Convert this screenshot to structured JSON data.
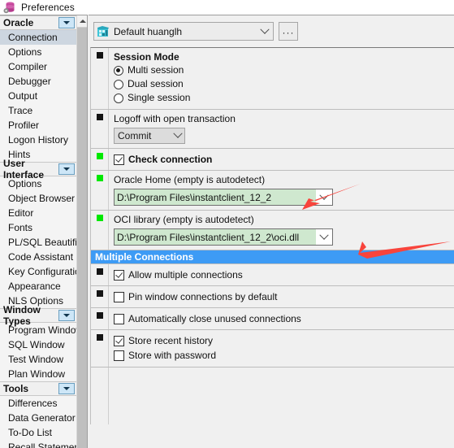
{
  "window": {
    "title": "Preferences",
    "icon": "database-gear-icon"
  },
  "sidebar": {
    "scroll_up_icon": "caret-up-icon",
    "groups": [
      {
        "label": "Oracle",
        "toggle_icon": "chevron-down-icon",
        "items": [
          {
            "label": "Connection",
            "selected": true
          },
          {
            "label": "Options",
            "selected": false
          },
          {
            "label": "Compiler",
            "selected": false
          },
          {
            "label": "Debugger",
            "selected": false
          },
          {
            "label": "Output",
            "selected": false
          },
          {
            "label": "Trace",
            "selected": false
          },
          {
            "label": "Profiler",
            "selected": false
          },
          {
            "label": "Logon History",
            "selected": false
          },
          {
            "label": "Hints",
            "selected": false
          }
        ]
      },
      {
        "label": "User Interface",
        "toggle_icon": "chevron-down-icon",
        "items": [
          {
            "label": "Options",
            "selected": false
          },
          {
            "label": "Object Browser",
            "selected": false
          },
          {
            "label": "Editor",
            "selected": false
          },
          {
            "label": "Fonts",
            "selected": false
          },
          {
            "label": "PL/SQL Beautifier",
            "selected": false
          },
          {
            "label": "Code Assistant",
            "selected": false
          },
          {
            "label": "Key Configuration",
            "selected": false
          },
          {
            "label": "Appearance",
            "selected": false
          },
          {
            "label": "NLS Options",
            "selected": false
          }
        ]
      },
      {
        "label": "Window Types",
        "toggle_icon": "chevron-down-icon",
        "items": [
          {
            "label": "Program Window",
            "selected": false
          },
          {
            "label": "SQL Window",
            "selected": false
          },
          {
            "label": "Test Window",
            "selected": false
          },
          {
            "label": "Plan Window",
            "selected": false
          }
        ]
      },
      {
        "label": "Tools",
        "toggle_icon": "chevron-down-icon",
        "items": [
          {
            "label": "Differences",
            "selected": false
          },
          {
            "label": "Data Generator",
            "selected": false
          },
          {
            "label": "To-Do List",
            "selected": false
          },
          {
            "label": "Recall Statement",
            "selected": false
          }
        ]
      }
    ]
  },
  "main": {
    "profile": {
      "icon": "preference-set-icon",
      "value": "Default huanglh",
      "chevron_icon": "chevron-down-icon",
      "more_button_label": "···"
    },
    "session_mode": {
      "title": "Session Mode",
      "marker": "black",
      "options": [
        {
          "label": "Multi session",
          "checked": true
        },
        {
          "label": "Dual session",
          "checked": false
        },
        {
          "label": "Single session",
          "checked": false
        }
      ]
    },
    "logoff": {
      "label": "Logoff with open transaction",
      "marker": "black",
      "value": "Commit",
      "chevron_icon": "chevron-down-icon"
    },
    "check_connection": {
      "label": "Check connection",
      "marker": "green",
      "checked": true
    },
    "oracle_home": {
      "label": "Oracle Home (empty is autodetect)",
      "marker": "green",
      "value": "D:\\Program Files\\instantclient_12_2",
      "chevron_icon": "chevron-down-icon"
    },
    "oci_library": {
      "label": "OCI library (empty is autodetect)",
      "marker": "green",
      "value": "D:\\Program Files\\instantclient_12_2\\oci.dll",
      "chevron_icon": "chevron-down-icon"
    },
    "multiple_connections": {
      "header": "Multiple Connections",
      "rows": [
        {
          "label": "Allow multiple connections",
          "checked": true,
          "marker": "black"
        },
        {
          "label": "Pin window connections by default",
          "checked": false,
          "marker": "black"
        },
        {
          "label": "Automatically close unused connections",
          "checked": false,
          "marker": "black"
        }
      ],
      "history_row": {
        "marker": "black",
        "store_recent_history": {
          "label": "Store recent history",
          "checked": true
        },
        "store_with_password": {
          "label": "Store with password",
          "checked": false
        }
      }
    }
  },
  "annotations": {
    "arrow_color": "#f8443c",
    "arrow_1_target": "oracle-home-label",
    "arrow_2_target": "oci-library-dropdown-chevron"
  },
  "colors": {
    "selection": "#cdd6e0",
    "section_header": "#3d9bf5",
    "green_marker": "#00e800",
    "green_field": "#cfe8cf",
    "group_button": "#cde6f7"
  }
}
